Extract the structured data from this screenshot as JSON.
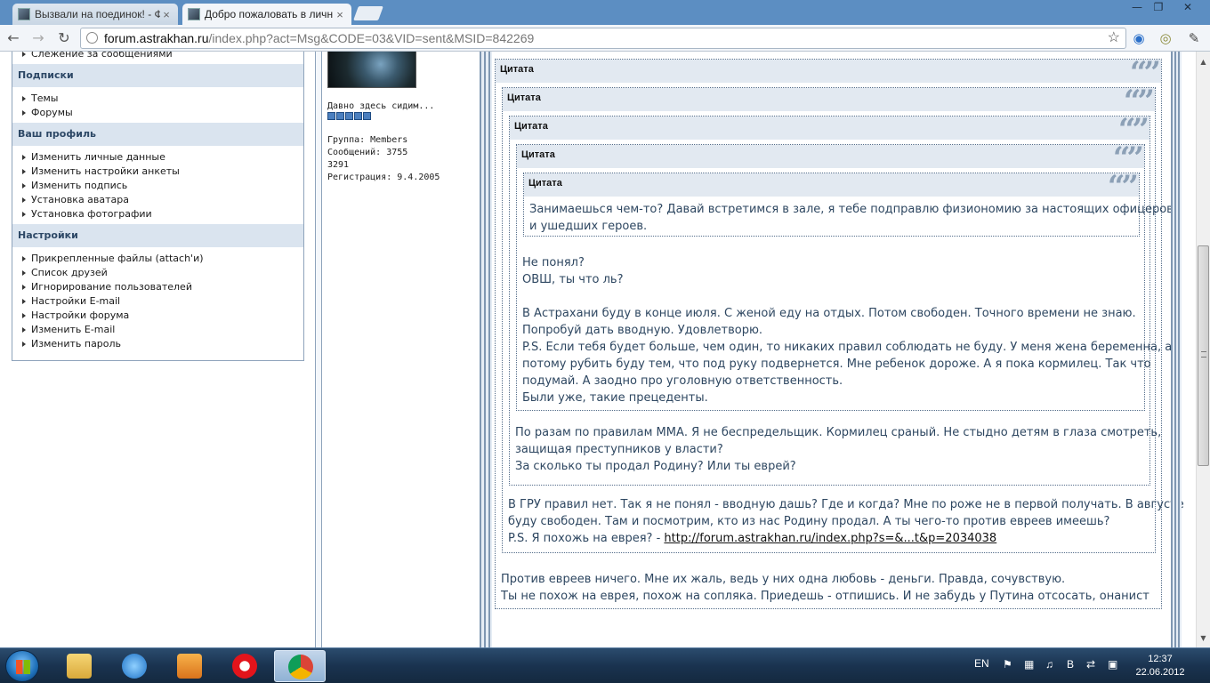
{
  "browser": {
    "tabs": [
      {
        "label": "Вызвали на поединок! - Ф",
        "active": false
      },
      {
        "label": "Добро пожаловать в личн",
        "active": true
      }
    ],
    "url_host": "forum.astrakhan.ru",
    "url_path": "/index.php?act=Msg&CODE=03&VID=sent&MSID=842269",
    "window_controls": {
      "minimize": "—",
      "maximize": "❐",
      "close": "✕"
    }
  },
  "sidebar": {
    "top_items": [
      {
        "label": "Слежение за сообщениями"
      }
    ],
    "sections": [
      {
        "title": "Подписки",
        "items": [
          {
            "label": "Темы"
          },
          {
            "label": "Форумы"
          }
        ]
      },
      {
        "title": "Ваш профиль",
        "items": [
          {
            "label": "Изменить личные данные"
          },
          {
            "label": "Изменить настройки анкеты"
          },
          {
            "label": "Изменить подпись"
          },
          {
            "label": "Установка аватара"
          },
          {
            "label": "Установка фотографии"
          }
        ]
      },
      {
        "title": "Настройки",
        "items": [
          {
            "label": "Прикрепленные файлы (attach'и)"
          },
          {
            "label": "Список друзей"
          },
          {
            "label": "Игнорирование пользователей"
          },
          {
            "label": "Настройки E-mail"
          },
          {
            "label": "Настройки форума"
          },
          {
            "label": "Изменить E-mail"
          },
          {
            "label": "Изменить пароль"
          }
        ]
      }
    ]
  },
  "profile": {
    "rank_title": "Давно здесь сидим...",
    "rank_pips": 5,
    "group": "Группа: Members",
    "posts": "Сообщений: 3755",
    "member_no": "3291",
    "registered": "Регистрация: 9.4.2005"
  },
  "post": {
    "quote_label": "Цитата",
    "quote_mark": "“”",
    "q5_lines": [
      "Занимаешься чем-то? Давай встретимся в зале, я тебе подправлю физиономию за настоящих офицеров",
      "и ушедших героев."
    ],
    "q4_lines": [
      "Не понял?",
      "ОВШ, ты что ль?",
      "",
      "В Астрахани буду в конце июля. С женой еду на отдых. Потом свободен. Точного времени не знаю.",
      "Попробуй дать вводную. Удовлетворю.",
      "P.S. Если тебя будет больше, чем один, то никаких правил соблюдать не буду. У меня жена беременна, а",
      "потому рубить буду тем, что под руку подвернется. Мне ребенок дороже. А я пока кормилец. Так что",
      "подумай. А заодно про уголовную ответственность.",
      "Были уже, такие прецеденты."
    ],
    "q3_lines": [
      "По разам по правилам ММА. Я не беспредельщик. Кормилец сраный. Не стыдно детям в глаза смотреть,",
      "защищая преступников у власти?",
      "За сколько ты продал Родину? Или ты еврей?"
    ],
    "q2_lines": [
      "В ГРУ правил нет. Так я не понял - вводную дашь? Где и когда? Мне по роже не в первой получать. В августе",
      "буду свободен. Там и посмотрим, кто из нас Родину продал. А ты чего-то против евреев имеешь?"
    ],
    "q2_last_prefix": "P.S. Я похожь на еврея? - ",
    "q2_link": "http://forum.astrakhan.ru/index.php?s=&...t&p=2034038",
    "q1_lines": [
      "Против евреев ничего. Мне их жаль, ведь у них одна любовь - деньги. Правда, сочувствую.",
      "Ты не похож на еврея, похож на сопляка. Приедешь - отпишись. И не забудь у Путина отсосать, онанист"
    ]
  },
  "taskbar": {
    "lang": "EN",
    "time": "12:37",
    "date": "22.06.2012"
  },
  "colors": {
    "section_bg": "#dae4ef",
    "section_text": "#2d4866",
    "quote_text": "#2e4761",
    "quote_head_bg": "#e2e9f1"
  }
}
